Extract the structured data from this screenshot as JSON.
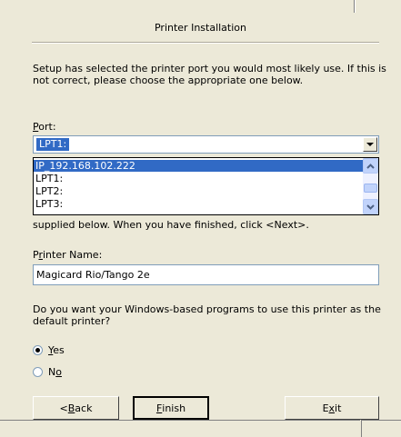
{
  "dialog": {
    "title": "Printer Installation",
    "intro": "Setup has selected the printer port you would most likely use. If this is not correct, please choose the appropriate one below.",
    "port_label_mnemonic": "P",
    "port_label_rest": "ort:",
    "port_value": "LPT1:",
    "port_options": [
      "IP_192.168.102.222",
      "LPT1:",
      "LPT2:",
      "LPT3:"
    ],
    "selected_option": "IP_192.168.102.222",
    "partial_text": "supplied below. When you have finished, click <Next>.",
    "printer_name_label_pre": "P",
    "printer_name_label_mnemonic": "r",
    "printer_name_label_post": "inter Name:",
    "printer_name_value": "Magicard Rio/Tango 2e",
    "default_question": "Do you want your Windows-based programs to use this printer as the default printer?",
    "radio_yes_mnemonic": "Y",
    "radio_yes_rest": "es",
    "radio_no_pre": "N",
    "radio_no_mnemonic": "o",
    "radio_yes_checked": true
  },
  "buttons": {
    "back_pre": "< ",
    "back_mnemonic": "B",
    "back_post": "ack",
    "finish_mnemonic": "F",
    "finish_post": "inish",
    "exit_pre": "E",
    "exit_mnemonic": "x",
    "exit_post": "it"
  }
}
